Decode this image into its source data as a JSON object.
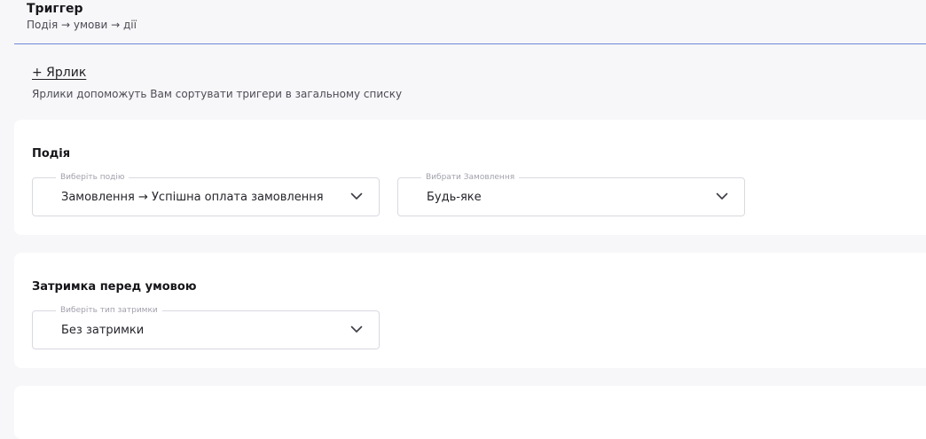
{
  "header": {
    "title": "Триггер",
    "subtitle": "Подія → умови → дії"
  },
  "labels": {
    "add_label": "+ Ярлик",
    "hint": "Ярлики допоможуть Вам сортувати тригери в загальному списку"
  },
  "event_card": {
    "title": "Подія",
    "event_select": {
      "legend": "Виберіть подію",
      "value": "Замовлення → Успішна оплата замовлення"
    },
    "order_select": {
      "legend": "Вибрати Замовлення",
      "value": "Будь-яке"
    }
  },
  "delay_card": {
    "title": "Затримка перед умовою",
    "delay_select": {
      "legend": "Виберіть тип затримки",
      "value": "Без затримки"
    }
  },
  "third_card": {
    "title": ""
  },
  "icons": {
    "dropdown": "chevron-down-icon"
  },
  "colors": {
    "header_border": "#6f87d8",
    "background": "#f7f7f9",
    "card": "#ffffff",
    "field_border": "#d9d9e1"
  }
}
